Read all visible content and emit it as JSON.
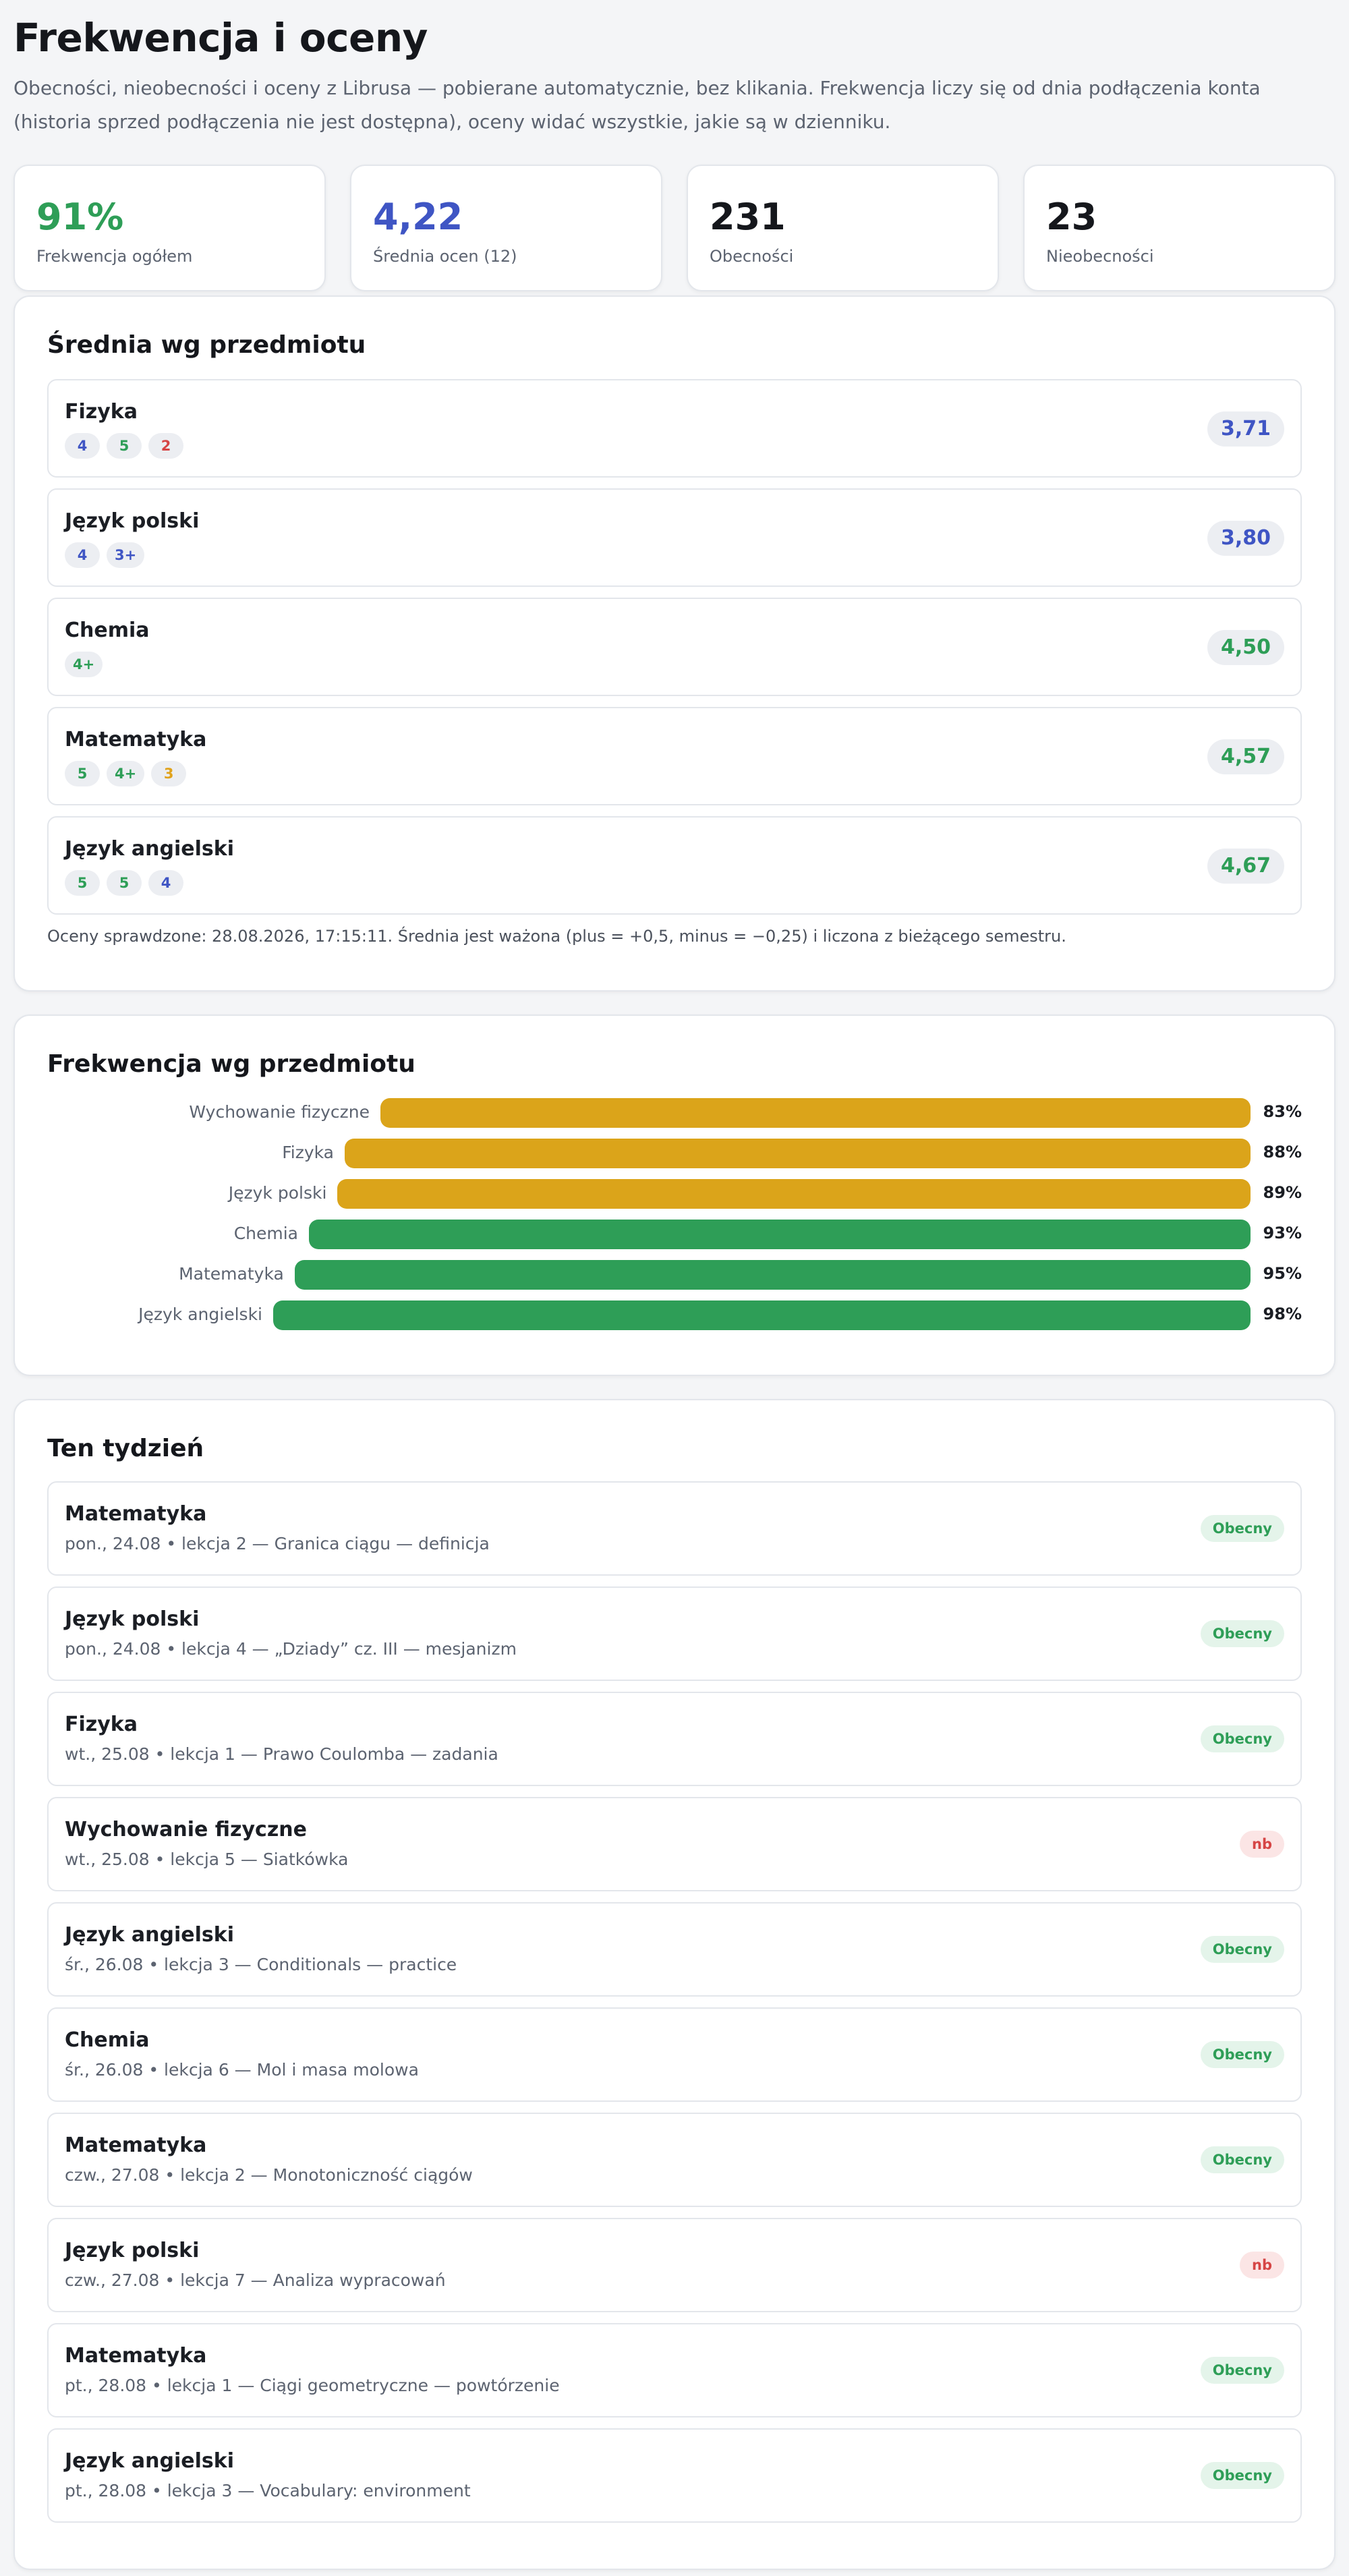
{
  "header": {
    "title": "Frekwencja i oceny",
    "intro": "Obecności, nieobecności i oceny z Librusa — pobierane automatycznie, bez klikania. Frekwencja liczy się od dnia podłączenia konta (historia sprzed podłączenia nie jest dostępna), oceny widać wszystkie, jakie są w dzienniku."
  },
  "stats": [
    {
      "value": "91%",
      "label": "Frekwencja ogółem",
      "color": "#2e9e57"
    },
    {
      "value": "4,22",
      "label": "Średnia ocen (12)",
      "color": "#3f55c4"
    },
    {
      "value": "231",
      "label": "Obecności",
      "color": "#15171c"
    },
    {
      "value": "23",
      "label": "Nieobecności",
      "color": "#15171c"
    }
  ],
  "averages": {
    "title": "Średnia wg przedmiotu",
    "subjects": [
      {
        "name": "Fizyka",
        "average": "3,71",
        "average_color": "#3f55c4",
        "grades": [
          {
            "g": "4",
            "color": "#3f55c4"
          },
          {
            "g": "5",
            "color": "#2e9e57"
          },
          {
            "g": "2",
            "color": "#d64545"
          }
        ]
      },
      {
        "name": "Język polski",
        "average": "3,80",
        "average_color": "#3f55c4",
        "grades": [
          {
            "g": "4",
            "color": "#3f55c4"
          },
          {
            "g": "3+",
            "color": "#3f55c4"
          }
        ]
      },
      {
        "name": "Chemia",
        "average": "4,50",
        "average_color": "#2e9e57",
        "grades": [
          {
            "g": "4+",
            "color": "#2e9e57"
          }
        ]
      },
      {
        "name": "Matematyka",
        "average": "4,57",
        "average_color": "#2e9e57",
        "grades": [
          {
            "g": "5",
            "color": "#2e9e57"
          },
          {
            "g": "4+",
            "color": "#2e9e57"
          },
          {
            "g": "3",
            "color": "#e0a21b"
          }
        ]
      },
      {
        "name": "Język angielski",
        "average": "4,67",
        "average_color": "#2e9e57",
        "grades": [
          {
            "g": "5",
            "color": "#2e9e57"
          },
          {
            "g": "5",
            "color": "#2e9e57"
          },
          {
            "g": "4",
            "color": "#3f55c4"
          }
        ]
      }
    ],
    "note": "Oceny sprawdzone: 28.08.2026, 17:15:11. Średnia jest ważona (plus = +0,5, minus = −0,25) i liczona z bieżącego semestru."
  },
  "attendance": {
    "title": "Frekwencja wg przedmiotu",
    "rows": [
      {
        "subject": "Wychowanie fizyczne",
        "percent": 83,
        "label": "83%",
        "color": "#dba41a"
      },
      {
        "subject": "Fizyka",
        "percent": 88,
        "label": "88%",
        "color": "#dba41a"
      },
      {
        "subject": "Język polski",
        "percent": 89,
        "label": "89%",
        "color": "#dba41a"
      },
      {
        "subject": "Chemia",
        "percent": 93,
        "label": "93%",
        "color": "#2e9e57"
      },
      {
        "subject": "Matematyka",
        "percent": 95,
        "label": "95%",
        "color": "#2e9e57"
      },
      {
        "subject": "Język angielski",
        "percent": 98,
        "label": "98%",
        "color": "#2e9e57"
      }
    ]
  },
  "week": {
    "title": "Ten tydzień",
    "lessons": [
      {
        "subject": "Matematyka",
        "meta": "pon., 24.08 • lekcja 2 — Granica ciągu — definicja",
        "status": "Obecny",
        "present": true
      },
      {
        "subject": "Język polski",
        "meta": "pon., 24.08 • lekcja 4 — „Dziady” cz. III — mesjanizm",
        "status": "Obecny",
        "present": true
      },
      {
        "subject": "Fizyka",
        "meta": "wt., 25.08 • lekcja 1 — Prawo Coulomba — zadania",
        "status": "Obecny",
        "present": true
      },
      {
        "subject": "Wychowanie fizyczne",
        "meta": "wt., 25.08 • lekcja 5 — Siatkówka",
        "status": "nb",
        "present": false
      },
      {
        "subject": "Język angielski",
        "meta": "śr., 26.08 • lekcja 3 — Conditionals — practice",
        "status": "Obecny",
        "present": true
      },
      {
        "subject": "Chemia",
        "meta": "śr., 26.08 • lekcja 6 — Mol i masa molowa",
        "status": "Obecny",
        "present": true
      },
      {
        "subject": "Matematyka",
        "meta": "czw., 27.08 • lekcja 2 — Monotoniczność ciągów",
        "status": "Obecny",
        "present": true
      },
      {
        "subject": "Język polski",
        "meta": "czw., 27.08 • lekcja 7 — Analiza wypracowań",
        "status": "nb",
        "present": false
      },
      {
        "subject": "Matematyka",
        "meta": "pt., 28.08 • lekcja 1 — Ciągi geometryczne — powtórzenie",
        "status": "Obecny",
        "present": true
      },
      {
        "subject": "Język angielski",
        "meta": "pt., 28.08 • lekcja 3 — Vocabulary: environment",
        "status": "Obecny",
        "present": true
      }
    ]
  }
}
